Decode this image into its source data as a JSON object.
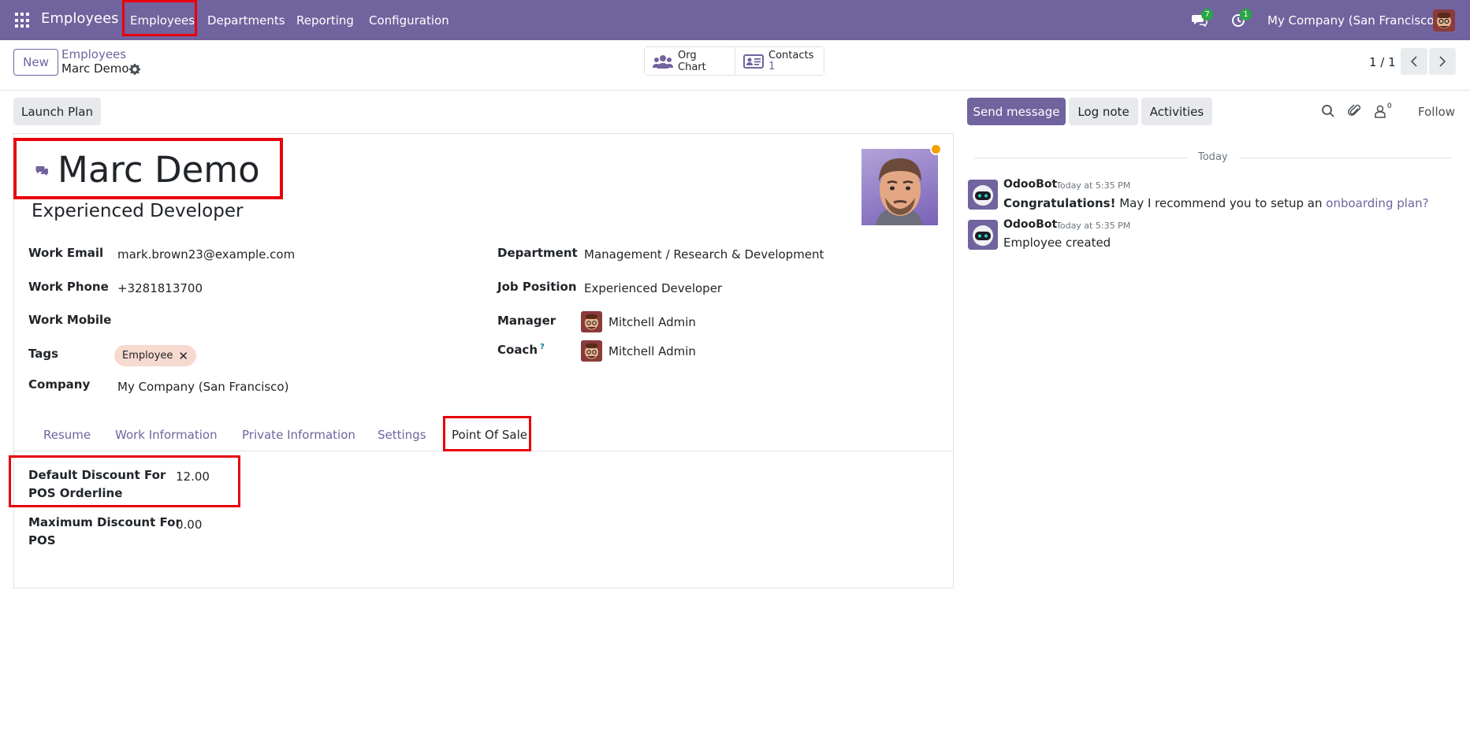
{
  "nav": {
    "app_name": "Employees",
    "menu": [
      "Employees",
      "Departments",
      "Reporting",
      "Configuration"
    ],
    "messages_count": "7",
    "activities_count": "1",
    "company": "My Company (San Francisco)"
  },
  "control_panel": {
    "new_label": "New",
    "breadcrumb_parent": "Employees",
    "breadcrumb_current": "Marc Demo",
    "org_chart_label": "Org Chart",
    "contacts_label": "Contacts",
    "contacts_count": "1",
    "pager": "1 / 1"
  },
  "form": {
    "launch_plan_label": "Launch Plan",
    "name": "Marc Demo",
    "job_title": "Experienced Developer",
    "left_fields": [
      {
        "label": "Work Email",
        "value": "mark.brown23@example.com"
      },
      {
        "label": "Work Phone",
        "value": "+3281813700"
      },
      {
        "label": "Work Mobile",
        "value": ""
      },
      {
        "label": "Tags",
        "value": ""
      },
      {
        "label": "Company",
        "value": "My Company (San Francisco)"
      }
    ],
    "tag": "Employee",
    "right_fields": [
      {
        "label": "Department",
        "value": "Management / Research & Development"
      },
      {
        "label": "Job Position",
        "value": "Experienced Developer"
      },
      {
        "label": "Manager",
        "value": "Mitchell Admin"
      },
      {
        "label": "Coach",
        "value": "Mitchell Admin"
      }
    ],
    "coach_help": "?",
    "tabs": [
      "Resume",
      "Work Information",
      "Private Information",
      "Settings",
      "Point Of Sale"
    ],
    "active_tab": "Point Of Sale",
    "pos_fields": [
      {
        "label_line1": "Default Discount For",
        "label_line2": "POS Orderline",
        "value": "12.00"
      },
      {
        "label_line1": "Maximum Discount For",
        "label_line2": "POS",
        "value": "0.00"
      }
    ]
  },
  "chatter": {
    "send_message_label": "Send message",
    "log_note_label": "Log note",
    "activities_label": "Activities",
    "followers_count": "0",
    "follow_label": "Follow",
    "date_separator": "Today",
    "messages": [
      {
        "author": "OdooBot",
        "time": "Today at 5:35 PM",
        "bold": "Congratulations!",
        "text": " May I recommend you to setup an ",
        "link": "onboarding plan?"
      },
      {
        "author": "OdooBot",
        "time": "Today at 5:35 PM",
        "text": "Employee created"
      }
    ]
  },
  "colors": {
    "brand": "#71639e",
    "highlight": "#e8000b",
    "badge": "#28a745",
    "presence": "#f3a101"
  }
}
